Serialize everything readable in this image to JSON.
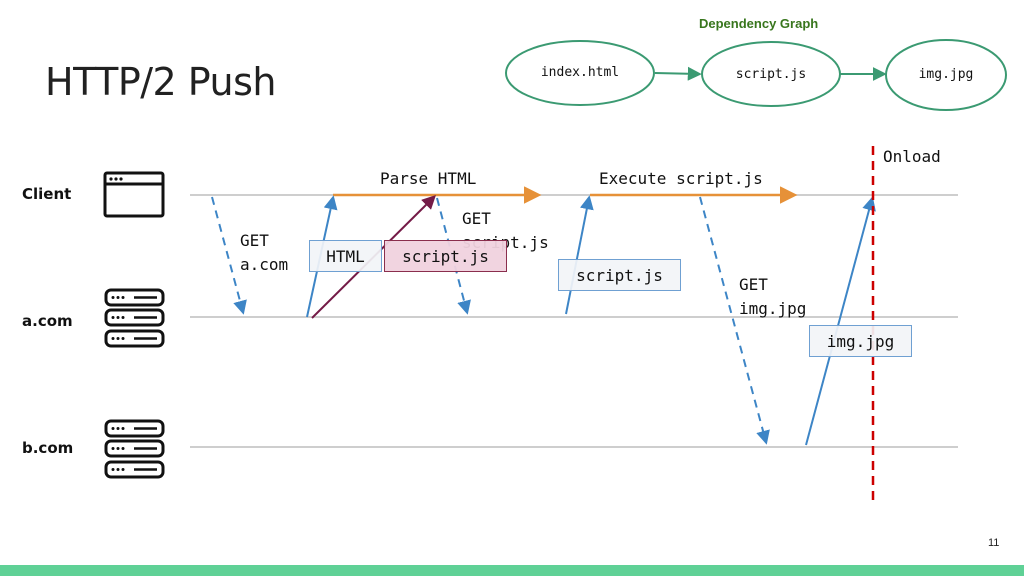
{
  "slide": {
    "title": "HTTP/2 Push",
    "page_number": "11",
    "footer_color": "#5fd196"
  },
  "dependency_graph": {
    "title": "Dependency Graph",
    "title_color": "#38761d",
    "node_color": "#3b9a72",
    "nodes": [
      {
        "id": "index",
        "label": "index.html"
      },
      {
        "id": "script",
        "label": "script.js"
      },
      {
        "id": "img",
        "label": "img.jpg"
      }
    ],
    "edges": [
      {
        "from": "index",
        "to": "script"
      },
      {
        "from": "script",
        "to": "img"
      }
    ]
  },
  "actors": [
    {
      "id": "client",
      "label": "Client",
      "icon": "browser-window-icon"
    },
    {
      "id": "acom",
      "label": "a.com",
      "icon": "server-stack-icon"
    },
    {
      "id": "bcom",
      "label": "b.com",
      "icon": "server-stack-icon"
    }
  ],
  "colors": {
    "request": "#3d85c6",
    "response": "#3d85c6",
    "push": "#741b47",
    "processing": "#e69138",
    "onload": "#cc0000",
    "timeline": "#bdbdbd"
  },
  "events": {
    "get_acom": {
      "label_line1": "GET",
      "label_line2": "a.com"
    },
    "html_response": {
      "label": "HTML"
    },
    "pushed_script": {
      "label": "script.js"
    },
    "parse_html": {
      "label": "Parse HTML"
    },
    "get_script": {
      "label_line1": "GET",
      "label_line2": "script.js"
    },
    "script_response": {
      "label": "script.js"
    },
    "execute_script": {
      "label": "Execute script.js"
    },
    "get_img": {
      "label_line1": "GET",
      "label_line2": "img.jpg"
    },
    "img_response": {
      "label": "img.jpg"
    },
    "onload": {
      "label": "Onload"
    }
  }
}
